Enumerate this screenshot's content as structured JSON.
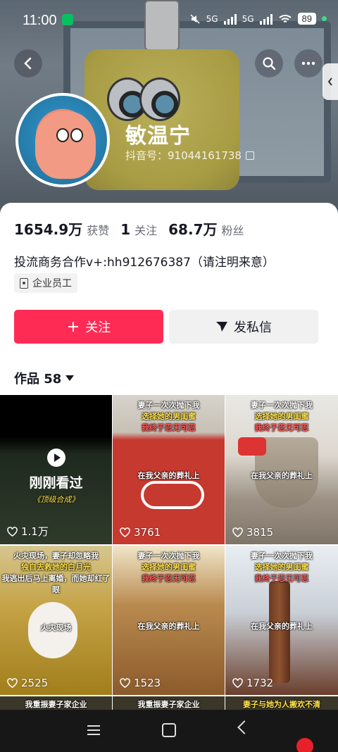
{
  "status_bar": {
    "time": "11:00",
    "network_1": "5G",
    "network_2": "5G",
    "battery": "89"
  },
  "header": {
    "back_icon": "chevron-left-icon",
    "search_icon": "search-icon",
    "more_icon": "more-horizontal-icon",
    "side_tab_icon": "chevron-left-icon"
  },
  "profile": {
    "name": "敏温宁",
    "douyin_id": "抖音号：91044161738"
  },
  "stats": [
    {
      "value": "1654.9万",
      "label": "获赞"
    },
    {
      "value": "1",
      "label": "关注"
    },
    {
      "value": "68.7万",
      "label": "粉丝"
    }
  ],
  "bio": "投流商务合作v+:hh912676387（请注明来意）",
  "tag": "企业员工",
  "buttons": {
    "follow": "关注",
    "follow_icon": "+",
    "message": "发私信"
  },
  "works": {
    "label": "作品 58"
  },
  "videos": [
    {
      "likes": "1.1万",
      "overlay": "刚刚看过",
      "bottom_caption": "《顶级合成》"
    },
    {
      "likes": "3761",
      "cap1": "妻子一次次抛下我",
      "cap2": "选择她的男闺蜜",
      "cap3": "我终于忍无可忍",
      "cap4": "在我父亲的葬礼上"
    },
    {
      "likes": "3815",
      "cap1": "妻子一次次抛下我",
      "cap2": "选择她的男闺蜜",
      "cap3": "我终于忍无可忍",
      "cap4": "在我父亲的葬礼上"
    },
    {
      "likes": "2525",
      "cap1": "火灾现场，妻子却忽略我",
      "cap2": "独自去救她的白月光",
      "cap3": "我逃出后马上离婚，而她却红了眼",
      "cap4": "火灾现场"
    },
    {
      "likes": "1523",
      "cap1": "妻子一次次抛下我",
      "cap2": "选择她的男闺蜜",
      "cap3": "我终于忍无可忍",
      "cap4": "在我父亲的葬礼上"
    },
    {
      "likes": "1732",
      "cap1": "妻子一次次抛下我",
      "cap2": "选择她的男闺蜜",
      "cap3": "我终于忍无可忍",
      "cap4": "在我父亲的葬礼上"
    }
  ],
  "partial_row": [
    "我重振妻子家企业",
    "我重振妻子家企业",
    "妻子与她为人搬欢不清"
  ],
  "colors": {
    "follow_button": "#fe2c55",
    "message_button": "#f1f1f2",
    "caption_yellow": "#ffe14a",
    "caption_red": "#ff5a5a"
  }
}
